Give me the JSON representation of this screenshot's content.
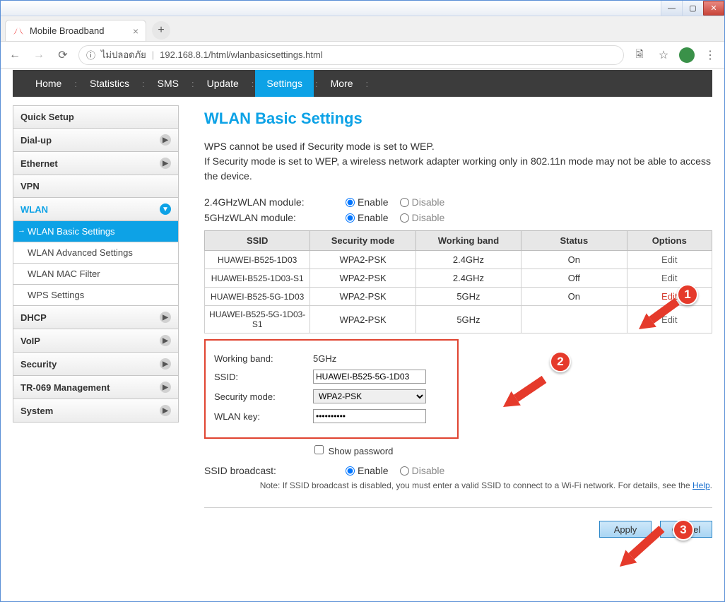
{
  "window": {
    "minimize": "—",
    "maximize": "▢",
    "close": "✕"
  },
  "browser": {
    "tab_title": "Mobile Broadband",
    "newtab": "+",
    "security_label": "ไม่ปลอดภัย",
    "url": "192.168.8.1/html/wlanbasicsettings.html",
    "info": "ⓘ",
    "translate": "⤭",
    "star": "☆",
    "menu": "⋮"
  },
  "topnav": {
    "items": [
      "Home",
      "Statistics",
      "SMS",
      "Update",
      "Settings",
      "More"
    ],
    "active_index": 4
  },
  "sidebar": {
    "items": [
      {
        "label": "Quick Setup",
        "expand": false
      },
      {
        "label": "Dial-up",
        "expand": true
      },
      {
        "label": "Ethernet",
        "expand": true
      },
      {
        "label": "VPN",
        "expand": false
      },
      {
        "label": "WLAN",
        "expand": true,
        "open": true,
        "highlight": true
      },
      {
        "label": "DHCP",
        "expand": true
      },
      {
        "label": "VoIP",
        "expand": true
      },
      {
        "label": "Security",
        "expand": true
      },
      {
        "label": "TR-069 Management",
        "expand": true
      },
      {
        "label": "System",
        "expand": true
      }
    ],
    "wlan_subitems": [
      {
        "label": "WLAN Basic Settings",
        "active": true
      },
      {
        "label": "WLAN Advanced Settings",
        "active": false
      },
      {
        "label": "WLAN MAC Filter",
        "active": false
      },
      {
        "label": "WPS Settings",
        "active": false
      }
    ]
  },
  "panel": {
    "title": "WLAN Basic Settings",
    "desc_line1": "WPS cannot be used if Security mode is set to WEP.",
    "desc_line2": "If Security mode is set to WEP, a wireless network adapter working only in 802.11n mode may not be able to access the device.",
    "module24_label": "2.4GHzWLAN module:",
    "module5_label": "5GHzWLAN module:",
    "enable": "Enable",
    "disable": "Disable",
    "table_headers": [
      "SSID",
      "Security mode",
      "Working band",
      "Status",
      "Options"
    ],
    "rows": [
      {
        "ssid": "HUAWEI-B525-1D03",
        "sec": "WPA2-PSK",
        "band": "2.4GHz",
        "status": "On",
        "edit": "Edit",
        "red": false
      },
      {
        "ssid": "HUAWEI-B525-1D03-S1",
        "sec": "WPA2-PSK",
        "band": "2.4GHz",
        "status": "Off",
        "edit": "Edit",
        "red": false
      },
      {
        "ssid": "HUAWEI-B525-5G-1D03",
        "sec": "WPA2-PSK",
        "band": "5GHz",
        "status": "On",
        "edit": "Edit",
        "red": true
      },
      {
        "ssid": "HUAWEI-B525-5G-1D03-S1",
        "sec": "WPA2-PSK",
        "band": "5GHz",
        "status": "",
        "edit": "Edit",
        "red": false
      }
    ],
    "edit": {
      "working_band_label": "Working band:",
      "working_band_value": "5GHz",
      "ssid_label": "SSID:",
      "ssid_value": "HUAWEI-B525-5G-1D03",
      "secmode_label": "Security mode:",
      "secmode_value": "WPA2-PSK",
      "key_label": "WLAN key:",
      "key_value": "••••••••••",
      "show_password": "Show password"
    },
    "ssid_broadcast_label": "SSID broadcast:",
    "note_text": "Note: If SSID broadcast is disabled, you must enter a valid SSID to connect to a Wi-Fi network. For details, see the ",
    "note_link": "Help",
    "apply": "Apply",
    "cancel": "Cancel"
  },
  "annotations": {
    "b1": "1",
    "b2": "2",
    "b3": "3"
  }
}
